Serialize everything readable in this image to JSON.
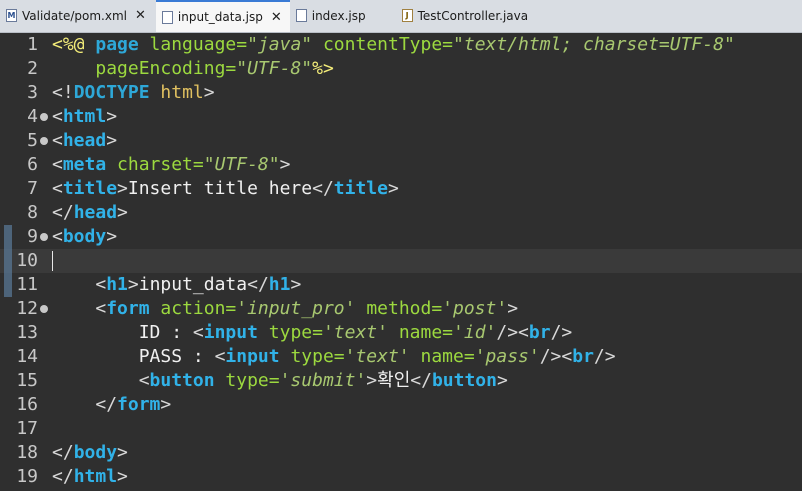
{
  "tabs": [
    {
      "label": "Validate/pom.xml",
      "icon": "xml-file-icon",
      "close": "✕",
      "active": false
    },
    {
      "label": "input_data.jsp",
      "icon": "jsp-file-icon",
      "close": "✕",
      "active": true
    },
    {
      "label": "index.jsp",
      "icon": "jsp-file-icon",
      "close": "",
      "active": false
    },
    {
      "label": "TestController.java",
      "icon": "java-file-icon",
      "close": "",
      "active": false
    }
  ],
  "editor": {
    "current_line": 10,
    "lines": [
      {
        "n": "1",
        "fold": false,
        "tokens": [
          [
            "dir",
            "<%@ "
          ],
          [
            "kw",
            "page "
          ],
          [
            "attr",
            "language="
          ],
          [
            "str",
            "\"java\""
          ],
          [
            "txt",
            " "
          ],
          [
            "attr",
            "contentType="
          ],
          [
            "str",
            "\"text/html; charset=UTF-8\""
          ]
        ]
      },
      {
        "n": "2",
        "fold": false,
        "tokens": [
          [
            "txt",
            "    "
          ],
          [
            "attr",
            "pageEncoding="
          ],
          [
            "str",
            "\"UTF-8\""
          ],
          [
            "dir",
            "%>"
          ]
        ]
      },
      {
        "n": "3",
        "fold": false,
        "tokens": [
          [
            "br",
            "<!"
          ],
          [
            "dt",
            "DOCTYPE "
          ],
          [
            "ht",
            "html"
          ],
          [
            "br",
            ">"
          ]
        ]
      },
      {
        "n": "4",
        "fold": true,
        "tokens": [
          [
            "br",
            "<"
          ],
          [
            "tag",
            "html"
          ],
          [
            "br",
            ">"
          ]
        ]
      },
      {
        "n": "5",
        "fold": true,
        "tokens": [
          [
            "br",
            "<"
          ],
          [
            "tag",
            "head"
          ],
          [
            "br",
            ">"
          ]
        ]
      },
      {
        "n": "6",
        "fold": false,
        "tokens": [
          [
            "br",
            "<"
          ],
          [
            "tag",
            "meta "
          ],
          [
            "attr",
            "charset="
          ],
          [
            "str",
            "\"UTF-8\""
          ],
          [
            "br",
            ">"
          ]
        ]
      },
      {
        "n": "7",
        "fold": false,
        "tokens": [
          [
            "br",
            "<"
          ],
          [
            "tag",
            "title"
          ],
          [
            "br",
            ">"
          ],
          [
            "txt",
            "Insert title here"
          ],
          [
            "br",
            "</"
          ],
          [
            "tag",
            "title"
          ],
          [
            "br",
            ">"
          ]
        ]
      },
      {
        "n": "8",
        "fold": false,
        "tokens": [
          [
            "br",
            "</"
          ],
          [
            "tag",
            "head"
          ],
          [
            "br",
            ">"
          ]
        ]
      },
      {
        "n": "9",
        "fold": true,
        "tokens": [
          [
            "br",
            "<"
          ],
          [
            "tag",
            "body"
          ],
          [
            "br",
            ">"
          ]
        ]
      },
      {
        "n": "10",
        "fold": false,
        "tokens": []
      },
      {
        "n": "11",
        "fold": false,
        "tokens": [
          [
            "txt",
            "    "
          ],
          [
            "br",
            "<"
          ],
          [
            "tag",
            "h1"
          ],
          [
            "br",
            ">"
          ],
          [
            "txt",
            "input_data"
          ],
          [
            "br",
            "</"
          ],
          [
            "tag",
            "h1"
          ],
          [
            "br",
            ">"
          ]
        ]
      },
      {
        "n": "12",
        "fold": true,
        "tokens": [
          [
            "txt",
            "    "
          ],
          [
            "br",
            "<"
          ],
          [
            "tag",
            "form "
          ],
          [
            "attr",
            "action="
          ],
          [
            "str",
            "'input_pro'"
          ],
          [
            "txt",
            " "
          ],
          [
            "attr",
            "method="
          ],
          [
            "str",
            "'post'"
          ],
          [
            "br",
            ">"
          ]
        ]
      },
      {
        "n": "13",
        "fold": false,
        "tokens": [
          [
            "txt",
            "        ID : "
          ],
          [
            "br",
            "<"
          ],
          [
            "tag",
            "input "
          ],
          [
            "attr",
            "type="
          ],
          [
            "str",
            "'text'"
          ],
          [
            "txt",
            " "
          ],
          [
            "attr",
            "name="
          ],
          [
            "str",
            "'id'"
          ],
          [
            "br",
            "/><"
          ],
          [
            "tag",
            "br"
          ],
          [
            "br",
            "/>"
          ]
        ]
      },
      {
        "n": "14",
        "fold": false,
        "tokens": [
          [
            "txt",
            "        PASS : "
          ],
          [
            "br",
            "<"
          ],
          [
            "tag",
            "input "
          ],
          [
            "attr",
            "type="
          ],
          [
            "str",
            "'text'"
          ],
          [
            "txt",
            " "
          ],
          [
            "attr",
            "name="
          ],
          [
            "str",
            "'pass'"
          ],
          [
            "br",
            "/><"
          ],
          [
            "tag",
            "br"
          ],
          [
            "br",
            "/>"
          ]
        ]
      },
      {
        "n": "15",
        "fold": false,
        "tokens": [
          [
            "txt",
            "        "
          ],
          [
            "br",
            "<"
          ],
          [
            "tag",
            "button "
          ],
          [
            "attr",
            "type="
          ],
          [
            "str",
            "'submit'"
          ],
          [
            "br",
            ">"
          ],
          [
            "txt",
            "확인"
          ],
          [
            "br",
            "</"
          ],
          [
            "tag",
            "button"
          ],
          [
            "br",
            ">"
          ]
        ]
      },
      {
        "n": "16",
        "fold": false,
        "tokens": [
          [
            "txt",
            "    "
          ],
          [
            "br",
            "</"
          ],
          [
            "tag",
            "form"
          ],
          [
            "br",
            ">"
          ]
        ]
      },
      {
        "n": "17",
        "fold": false,
        "tokens": []
      },
      {
        "n": "18",
        "fold": false,
        "tokens": [
          [
            "br",
            "</"
          ],
          [
            "tag",
            "body"
          ],
          [
            "br",
            ">"
          ]
        ]
      },
      {
        "n": "19",
        "fold": false,
        "tokens": [
          [
            "br",
            "</"
          ],
          [
            "tag",
            "html"
          ],
          [
            "br",
            ">"
          ]
        ]
      }
    ]
  }
}
